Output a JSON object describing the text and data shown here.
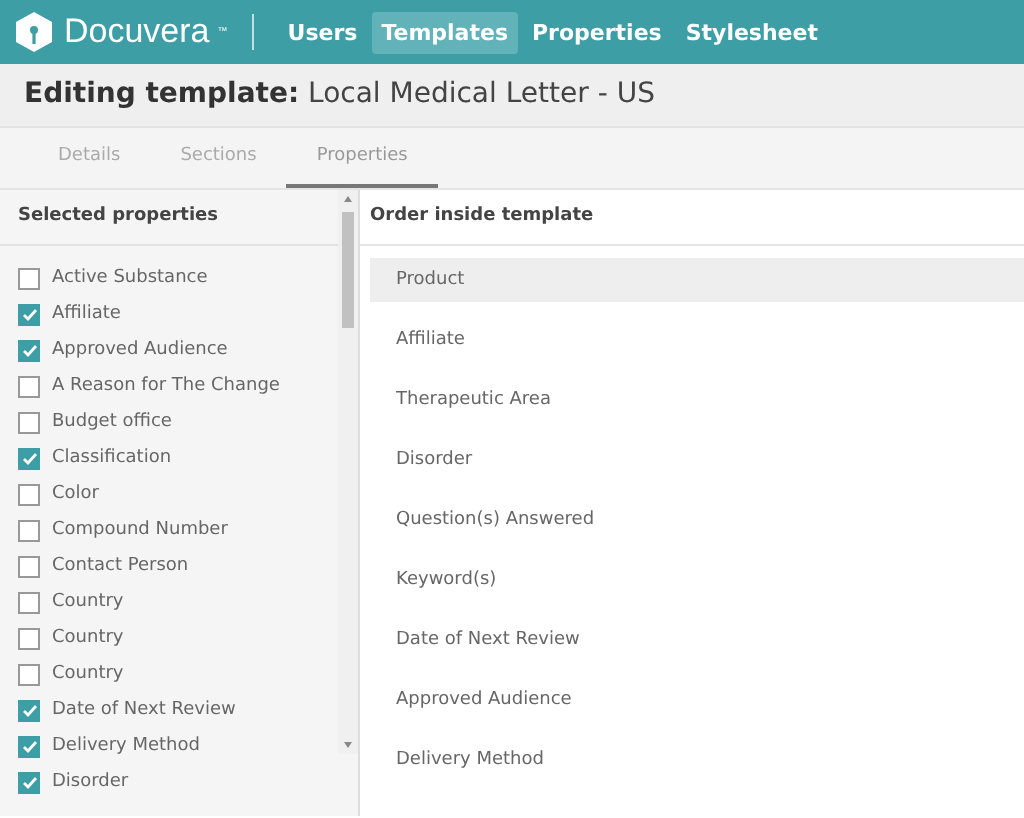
{
  "header": {
    "brand": "Docuvera$^{™}$",
    "nav": [
      {
        "label": "Users",
        "selected": false
      },
      {
        "label": "Templates",
        "selected": true
      },
      {
        "label": "Properties",
        "selected": false
      },
      {
        "label": "Stylesheet",
        "selected": false
      }
    ]
  },
  "title": "**Editing template:** Local Medical Letter - US",
  "tabs": [
    {
      "label": "Details",
      "selected": false
    },
    {
      "label": "Sections",
      "selected": false
    },
    {
      "label": "Properties",
      "selected": true
    }
  ],
  "selected_properties": {
    "heading": "Selected properties",
    "items": [
      {
        "label": "Active Substance",
        "checked": false
      },
      {
        "label": "Affiliate",
        "checked": true
      },
      {
        "label": "Approved Audience",
        "checked": true
      },
      {
        "label": "A Reason for The Change",
        "checked": false
      },
      {
        "label": "Budget office",
        "checked": false
      },
      {
        "label": "Classification",
        "checked": true
      },
      {
        "label": "Color",
        "checked": false
      },
      {
        "label": "Compound Number",
        "checked": false
      },
      {
        "label": "Contact Person",
        "checked": false
      },
      {
        "label": "Country",
        "checked": false
      },
      {
        "label": "Country",
        "checked": false
      },
      {
        "label": "Country",
        "checked": false
      },
      {
        "label": "Date of Next Review",
        "checked": true
      },
      {
        "label": "Delivery Method",
        "checked": true
      },
      {
        "label": "Disorder",
        "checked": true
      }
    ]
  },
  "order": {
    "heading": "Order inside template",
    "items": [
      {
        "label": "Product",
        "selected": true
      },
      {
        "label": "Affiliate",
        "selected": false
      },
      {
        "label": "Therapeutic Area",
        "selected": false
      },
      {
        "label": "Disorder",
        "selected": false
      },
      {
        "label": "Question(s) Answered",
        "selected": false
      },
      {
        "label": "Keyword(s)",
        "selected": false
      },
      {
        "label": "Date of Next Review",
        "selected": false
      },
      {
        "label": "Approved Audience",
        "selected": false
      },
      {
        "label": "Delivery Method",
        "selected": false
      }
    ]
  }
}
